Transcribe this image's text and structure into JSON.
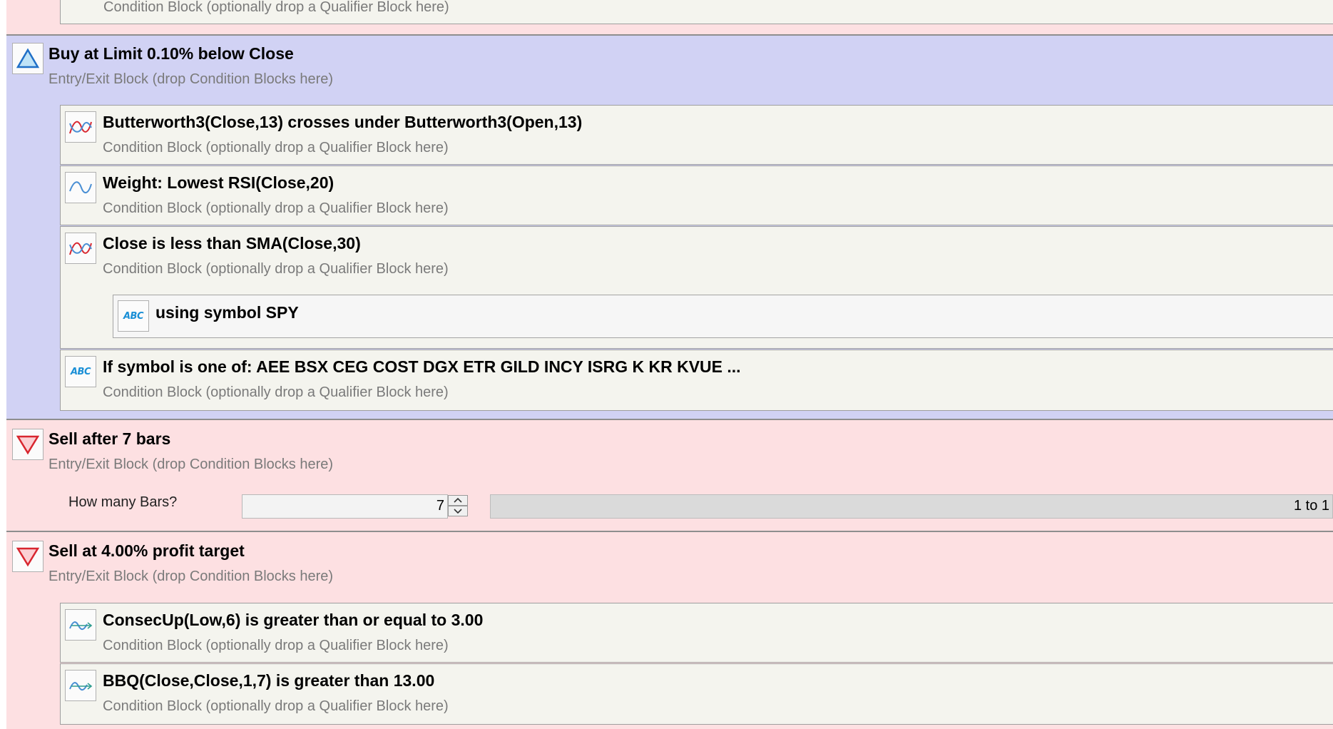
{
  "top_partial": {
    "subtitle": "Condition Block (optionally drop a Qualifier Block here)"
  },
  "entry_block": {
    "title": "Buy at Limit 0.10% below Close",
    "subtitle": "Entry/Exit Block (drop Condition Blocks here)",
    "icon": "triangle-up-icon",
    "conditions": [
      {
        "title": "Butterworth3(Close,13) crosses under Butterworth3(Open,13)",
        "subtitle": "Condition Block (optionally drop a Qualifier Block here)",
        "icon": "crossover-icon"
      },
      {
        "title": "Weight: Lowest RSI(Close,20)",
        "subtitle": "Condition Block (optionally drop a Qualifier Block here)",
        "icon": "wave-icon"
      },
      {
        "title": "Close is less than SMA(Close,30)",
        "subtitle": "Condition Block (optionally drop a Qualifier Block here)",
        "icon": "crossover-icon"
      },
      {
        "title": "If symbol is one of: AEE BSX CEG COST DGX ETR GILD INCY ISRG K KR KVUE ...",
        "subtitle": "Condition Block (optionally drop a Qualifier Block here)",
        "icon": "abc-icon"
      }
    ],
    "qualifier": {
      "title": "using symbol SPY",
      "icon": "abc-icon"
    }
  },
  "exit_bars_block": {
    "title": "Sell after 7 bars",
    "subtitle": "Entry/Exit Block (drop Condition Blocks here)",
    "icon": "triangle-down-icon",
    "param_label": "How many Bars?",
    "param_value": "7",
    "range_text": "1 to 1"
  },
  "exit_profit_block": {
    "title": "Sell at 4.00% profit target",
    "subtitle": "Entry/Exit Block (drop Condition Blocks here)",
    "icon": "triangle-down-icon",
    "conditions": [
      {
        "title": "ConsecUp(Low,6) is greater than or equal to 3.00",
        "subtitle": "Condition Block (optionally drop a Qualifier Block here)",
        "icon": "wave-arrow-icon"
      },
      {
        "title": "BBQ(Close,Close,1,7) is greater than 13.00",
        "subtitle": "Condition Block (optionally drop a Qualifier Block here)",
        "icon": "wave-arrow-icon"
      }
    ]
  },
  "abc_label": "ABC",
  "colors": {
    "entry_bg": "#d1d2f4",
    "exit_bg": "#fde0e2",
    "condition_bg": "#f4f4ee"
  }
}
